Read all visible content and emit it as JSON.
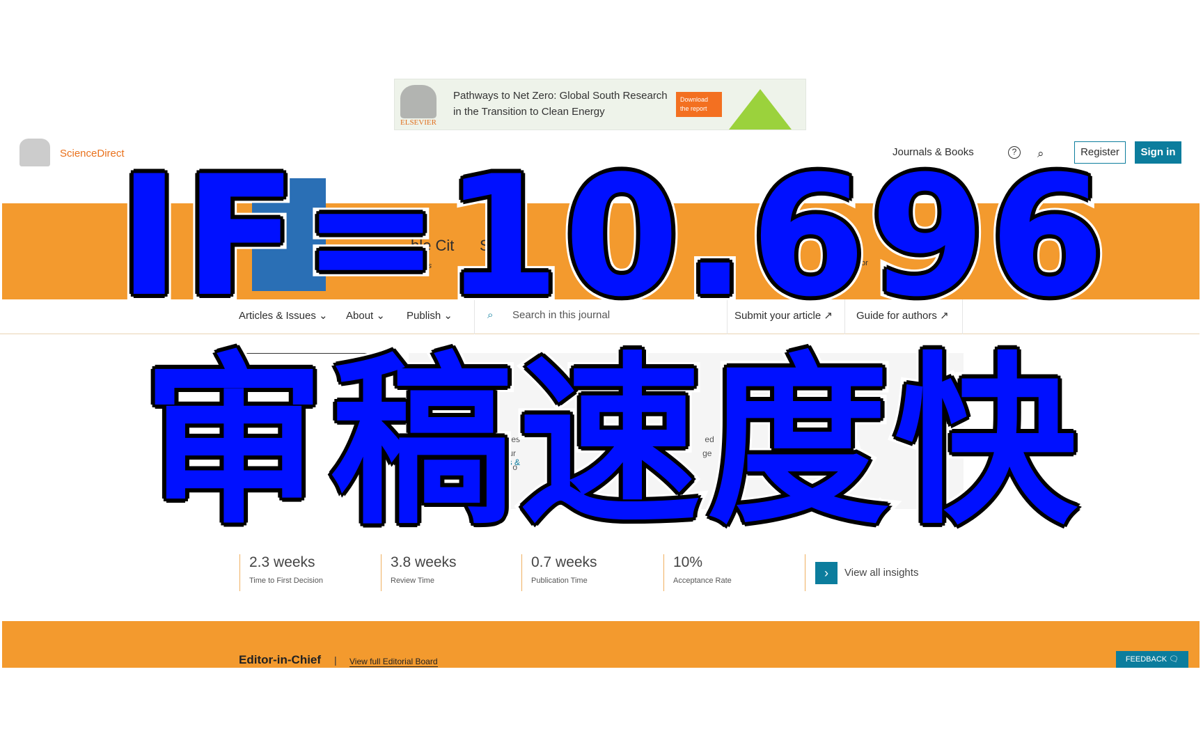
{
  "ad": {
    "brand": "ELSEVIER",
    "text_line1": "Pathways to Net Zero: Global South Research",
    "text_line2": "in the Transition to Clean Energy",
    "button": "Download the report"
  },
  "header": {
    "logo": "ScienceDirect",
    "journals_books": "Journals & Books",
    "help_icon": "question-circle-icon",
    "search_icon": "search-icon",
    "register": "Register",
    "signin": "Sign in"
  },
  "journal": {
    "title_partial": "ble Cit      Soc",
    "subtitle_partial": "ccess",
    "score_partial": "4.",
    "score_label_partial": "eScor"
  },
  "nav": {
    "items": [
      "Articles & Issues",
      "About",
      "Publish"
    ],
    "search_placeholder": "Search in this journal",
    "submit": "Submit your article",
    "guide": "Guide for authors"
  },
  "panel": {
    "title_partial": "h",
    "desc_lines": [
      "Cities                                        focus                               ed",
      "g, ur                                         sustain                            ge",
      "ion o                                         he ..."
    ],
    "link_partial": "ims &"
  },
  "stats": [
    {
      "value": "2.3 weeks",
      "label": "Time to First Decision"
    },
    {
      "value": "3.8 weeks",
      "label": "Review Time"
    },
    {
      "value": "0.7 weeks",
      "label": "Publication Time"
    },
    {
      "value": "10%",
      "label": "Acceptance Rate"
    }
  ],
  "insights": "View all insights",
  "editorial": {
    "heading": "Editor-in-Chief",
    "separator": "|",
    "board_link": "View full Editorial Board"
  },
  "feedback": "FEEDBACK",
  "overlay": {
    "line1": "IF=10.696",
    "line2": "审稿速度快"
  },
  "colors": {
    "accent_orange": "#f39a2e",
    "brand_teal": "#0c7d9d",
    "overlay_blue": "#0010ff"
  }
}
